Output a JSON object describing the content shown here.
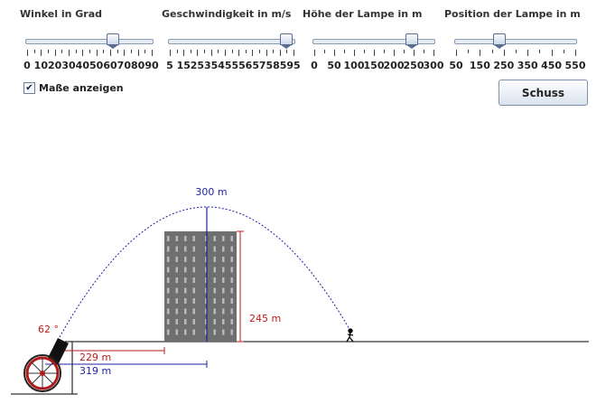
{
  "sliders": [
    {
      "label": "Winkel in Grad",
      "ticks": [
        "0",
        "10",
        "20",
        "30",
        "40",
        "50",
        "60",
        "70",
        "80",
        "90"
      ],
      "value": 62,
      "min": 0,
      "max": 90
    },
    {
      "label": "Geschwindigkeit in m/s",
      "ticks": [
        "5",
        "15",
        "25",
        "35",
        "45",
        "55",
        "65",
        "75",
        "85",
        "95"
      ],
      "value": 90,
      "min": 5,
      "max": 95
    },
    {
      "label": "Höhe der Lampe in m",
      "ticks": [
        "0",
        "50",
        "100",
        "150",
        "200",
        "250",
        "300"
      ],
      "value": 245,
      "min": 0,
      "max": 300
    },
    {
      "label": "Position der Lampe in m",
      "ticks": [
        "50",
        "150",
        "250",
        "350",
        "450",
        "550"
      ],
      "value": 230,
      "min": 50,
      "max": 550
    }
  ],
  "checkbox": {
    "label": "Maße anzeigen",
    "mark": "✔"
  },
  "shoot_button": {
    "label": "Schuss"
  },
  "measurements": {
    "angle": "62 °",
    "max_height": "300 m",
    "lamp_height": "245 m",
    "lamp_position": "229 m",
    "apex_distance": "319 m"
  },
  "colors": {
    "blue": "#1f1fa8",
    "red": "#c21a1a",
    "building": "#6f6f6f"
  },
  "icons": {
    "cannon": "cannon-icon",
    "person": "person-icon",
    "building": "building-icon"
  }
}
